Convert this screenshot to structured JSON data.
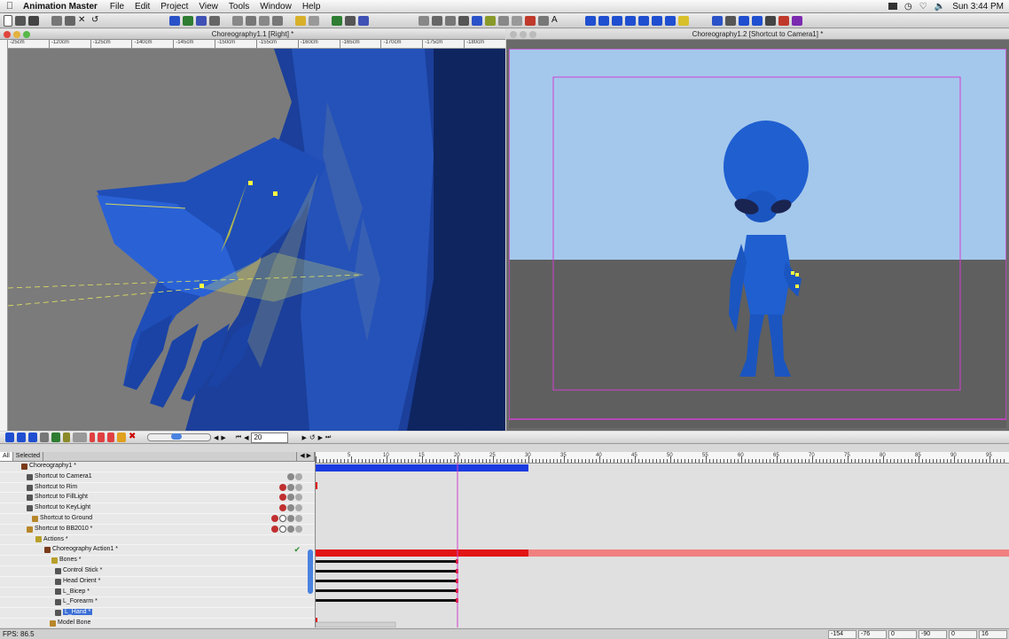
{
  "menubar": {
    "app_name": "Animation Master",
    "items": [
      "File",
      "Edit",
      "Project",
      "View",
      "Tools",
      "Window",
      "Help"
    ],
    "clock": "Sun 3:44 PM"
  },
  "windows": {
    "left_title": "Choreography1.1 [Right] *",
    "right_title": "Choreography1.2 [Shortcut to Camera1] *",
    "ruler_labels": [
      "-25cm",
      "-120cm",
      "-125cm",
      "-140cm",
      "-145cm",
      "-150cm",
      "-155cm",
      "-160cm",
      "-165cm",
      "-170cm",
      "-175cm",
      "-180cm"
    ]
  },
  "timebar": {
    "frame_value": "20"
  },
  "pws": {
    "tabs": [
      "All",
      "Selected"
    ],
    "rows": [
      {
        "label": "Choreography1 *",
        "indent": 2
      },
      {
        "label": "Shortcut to Camera1",
        "indent": 3
      },
      {
        "label": "Shortcut to Rim",
        "indent": 3
      },
      {
        "label": "Shortcut to FillLight",
        "indent": 3
      },
      {
        "label": "Shortcut to KeyLight",
        "indent": 3
      },
      {
        "label": "Shortcut to Ground",
        "indent": 3
      },
      {
        "label": "Shortcut to BB2010 *",
        "indent": 3
      },
      {
        "label": "Actions *",
        "indent": 4
      },
      {
        "label": "Choreography Action1 *",
        "indent": 5
      },
      {
        "label": "Bones *",
        "indent": 6
      },
      {
        "label": "Control Stick *",
        "indent": 7
      },
      {
        "label": "Head Orient *",
        "indent": 7
      },
      {
        "label": "L_Bicep *",
        "indent": 7
      },
      {
        "label": "L_Forearm *",
        "indent": 7
      },
      {
        "label": "L_Hand *",
        "indent": 7,
        "selected": true
      },
      {
        "label": "Model Bone",
        "indent": 6
      }
    ]
  },
  "timeline": {
    "ruler_labels": [
      "5",
      "10",
      "15",
      "20",
      "25",
      "30",
      "35",
      "40",
      "45",
      "50",
      "55",
      "60",
      "65",
      "70",
      "75",
      "80",
      "85",
      "90",
      "95"
    ],
    "current_frame": 20
  },
  "status": {
    "fps": "FPS: 86.5",
    "coords": [
      "-154",
      "-76",
      "0",
      "-90",
      "0",
      "16"
    ]
  },
  "colors": {
    "sky": "#a4c8ec",
    "ground": "#5f5f5f",
    "alien_blue": "#1f5fd0",
    "timeline_blue": "#1a3be0",
    "timeline_red": "#e21414",
    "timeline_pink": "#f08080",
    "frame_marker": "#d040d0"
  }
}
